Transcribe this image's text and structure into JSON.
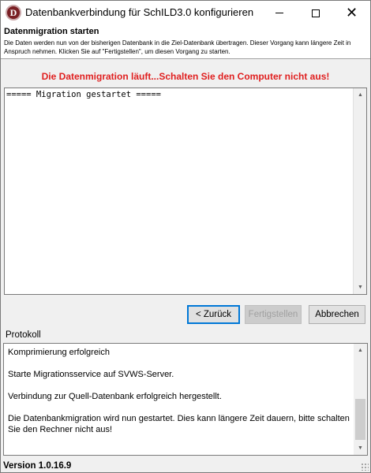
{
  "window": {
    "title": "Datenbankverbindung für SchILD3.0 konfigurieren",
    "icon_letter": "D"
  },
  "header": {
    "title": "Datenmigration starten",
    "description": "Die Daten werden nun von der bisherigen Datenbank in die Ziel-Datenbank übertragen. Dieser Vorgang kann längere Zeit in Anspruch nehmen. Klicken Sie auf \"Fertigstellen\", um diesen Vorgang zu starten."
  },
  "main": {
    "warning": "Die Datenmigration läuft...Schalten Sie den Computer nicht aus!",
    "log_text": "===== Migration gestartet ====="
  },
  "buttons": {
    "back": "< Zurück",
    "finish": "Fertigstellen",
    "cancel": "Abbrechen"
  },
  "protocol": {
    "label": "Protokoll",
    "lines": [
      "Komprimierung erfolgreich",
      "Starte Migrationsservice auf SVWS-Server.",
      "Verbindung zur Quell-Datenbank erfolgreich hergestellt.",
      "Die Datenbankmigration wird nun gestartet. Dies kann längere Zeit dauern, bitte schalten Sie den Rechner nicht aus!"
    ]
  },
  "footer": {
    "version": "Version 1.0.16.9"
  },
  "colors": {
    "warning": "#e02020",
    "accent": "#0078d7",
    "app_icon": "#7a1f24"
  }
}
